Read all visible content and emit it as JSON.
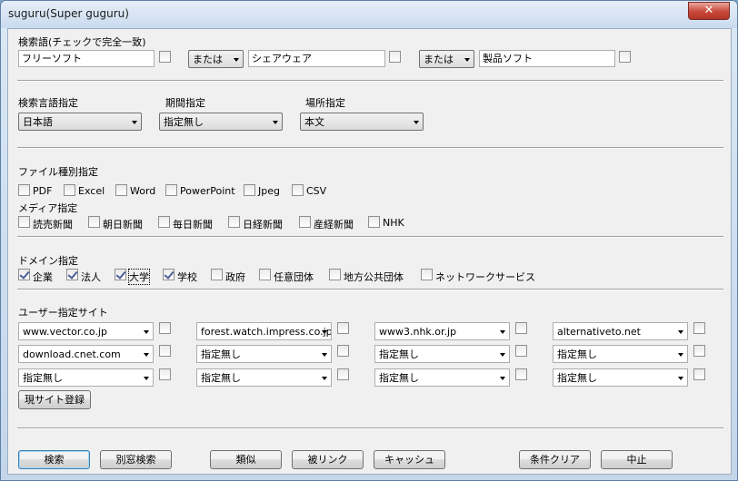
{
  "window": {
    "title": "suguru(Super guguru)",
    "close_glyph": "✕"
  },
  "keywords": {
    "label": "検索語(チェックで完全一致)",
    "fields": [
      {
        "value": "フリーソフト",
        "checked": false
      },
      {
        "value": "シェアウェア",
        "checked": false
      },
      {
        "value": "製品ソフト",
        "checked": false
      }
    ],
    "operators": [
      "または",
      "または"
    ]
  },
  "filters": {
    "language": {
      "label": "検索言語指定",
      "value": "日本語"
    },
    "period": {
      "label": "期間指定",
      "value": "指定無し"
    },
    "location": {
      "label": "場所指定",
      "value": "本文"
    }
  },
  "file_types": {
    "label": "ファイル種別指定",
    "items": [
      {
        "label": "PDF",
        "checked": false
      },
      {
        "label": "Excel",
        "checked": false
      },
      {
        "label": "Word",
        "checked": false
      },
      {
        "label": "PowerPoint",
        "checked": false
      },
      {
        "label": "Jpeg",
        "checked": false
      },
      {
        "label": "CSV",
        "checked": false
      }
    ]
  },
  "media": {
    "label": "メディア指定",
    "items": [
      {
        "label": "読売新聞",
        "checked": false
      },
      {
        "label": "朝日新聞",
        "checked": false
      },
      {
        "label": "毎日新聞",
        "checked": false
      },
      {
        "label": "日経新聞",
        "checked": false
      },
      {
        "label": "産経新聞",
        "checked": false
      },
      {
        "label": "NHK",
        "checked": false
      }
    ]
  },
  "domains": {
    "label": "ドメイン指定",
    "items": [
      {
        "label": "企業",
        "checked": true
      },
      {
        "label": "法人",
        "checked": true
      },
      {
        "label": "大学",
        "checked": true
      },
      {
        "label": "学校",
        "checked": true
      },
      {
        "label": "政府",
        "checked": false
      },
      {
        "label": "任意団体",
        "checked": false
      },
      {
        "label": "地方公共団体",
        "checked": false
      },
      {
        "label": "ネットワークサービス",
        "checked": false
      }
    ]
  },
  "user_sites": {
    "label": "ユーザー指定サイト",
    "rows": [
      [
        "www.vector.co.jp",
        "forest.watch.impress.co.jp",
        "www3.nhk.or.jp",
        "alternativeto.net"
      ],
      [
        "download.cnet.com",
        "指定無し",
        "指定無し",
        "指定無し"
      ],
      [
        "指定無し",
        "指定無し",
        "指定無し",
        "指定無し"
      ]
    ],
    "register_button": "現サイト登録"
  },
  "buttons": {
    "search": "検索",
    "search_new_window": "別窓検索",
    "similar": "類似",
    "backlinks": "被リンク",
    "cache": "キャッシュ",
    "clear": "条件クリア",
    "cancel": "中止"
  }
}
